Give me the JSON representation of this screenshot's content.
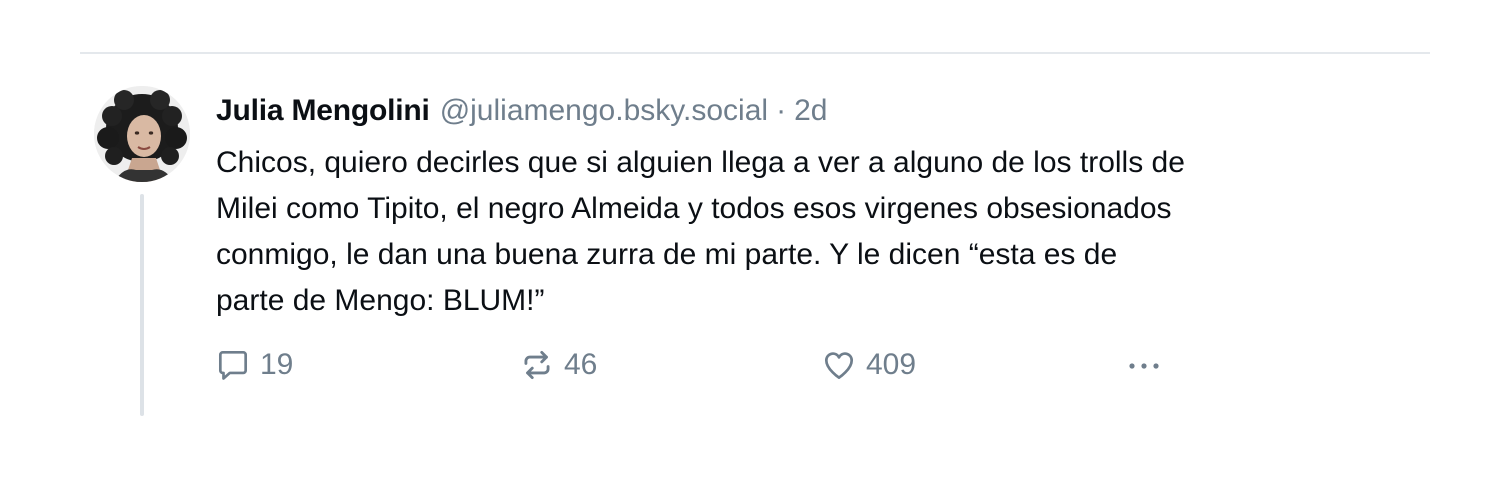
{
  "post": {
    "author_name": "Julia Mengolini",
    "author_handle": "@juliamengo.bsky.social",
    "separator": "·",
    "time": "2d",
    "lines": [
      "Chicos, quiero decirles que si alguien llega a ver a alguno de los trolls de",
      "Milei como Tipito, el negro Almeida y todos esos virgenes obsesionados",
      "conmigo, le dan una buena zurra de mi parte. Y le dicen “esta es de",
      "parte de Mengo: BLUM!”"
    ],
    "reply_count": "19",
    "repost_count": "46",
    "like_count": "409",
    "more_label": "···"
  },
  "icons": {
    "reply": "reply-bubble-icon",
    "repost": "repost-arrows-icon",
    "like": "heart-icon",
    "more": "more-dots-icon"
  },
  "colors": {
    "text": "#0b0f14",
    "muted": "#6f7e8c",
    "divider": "#e4e8ec",
    "thread_line": "#dde2e7"
  }
}
